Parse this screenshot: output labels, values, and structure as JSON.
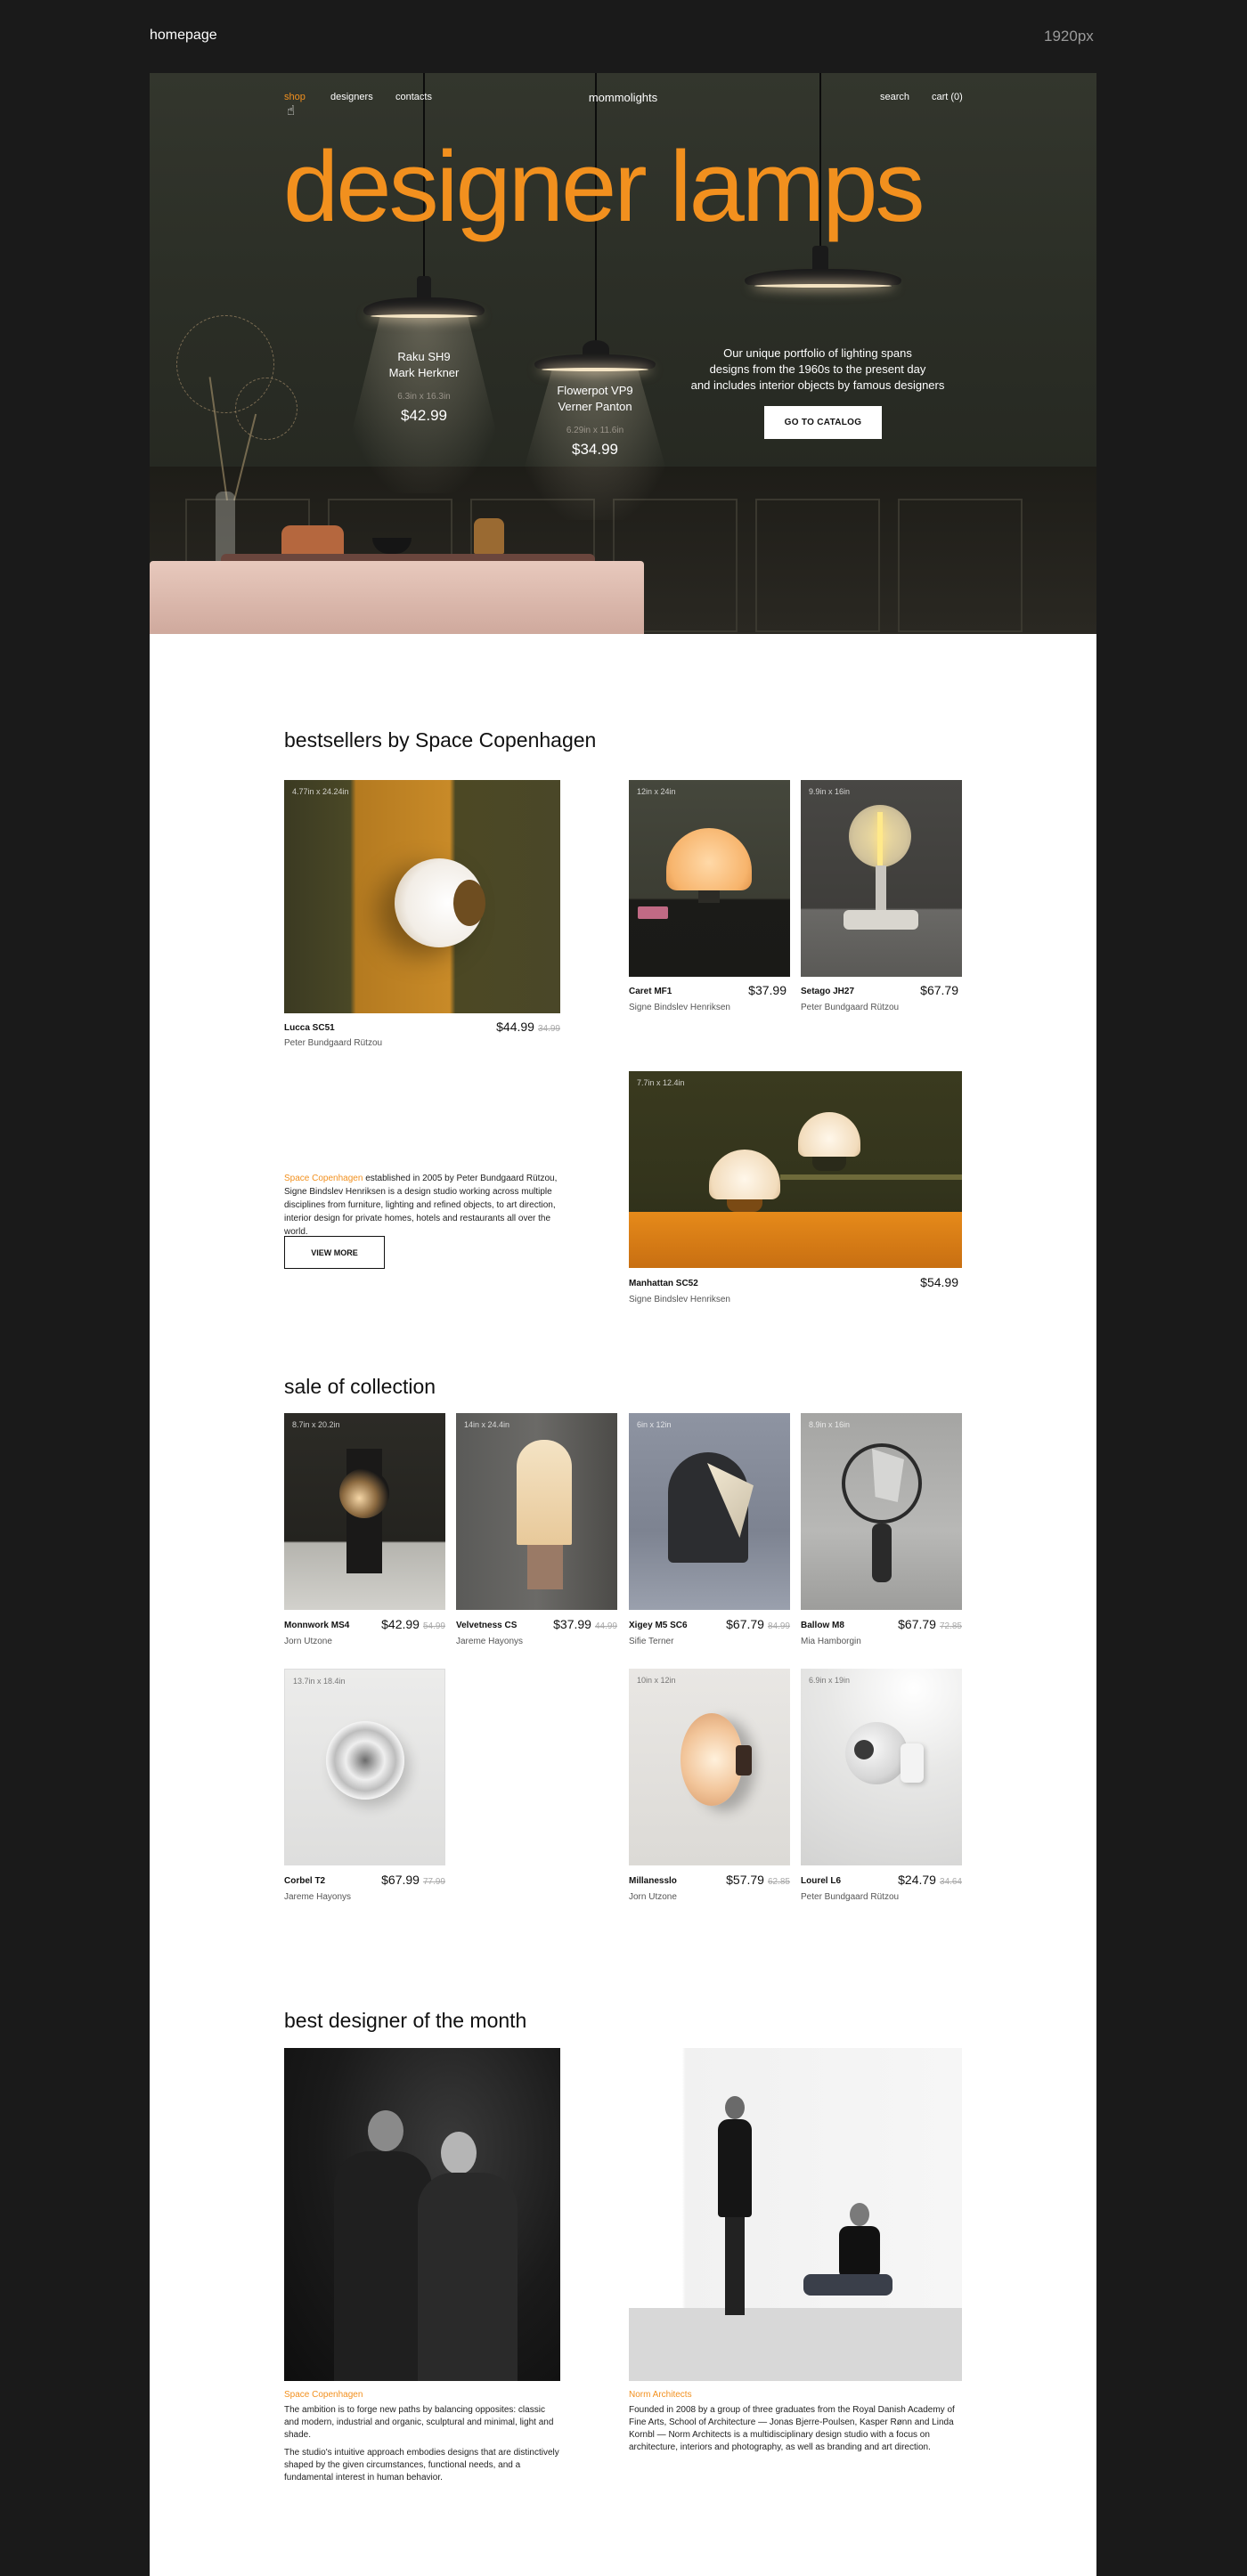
{
  "meta": {
    "page_label": "homepage",
    "width_label": "1920px"
  },
  "nav": {
    "shop": "shop",
    "designers": "designers",
    "contacts": "contacts",
    "brand": "mommolights",
    "search": "search",
    "cart": "cart (0)"
  },
  "hero": {
    "title": "designer lamps",
    "lamp1": {
      "name1": "Raku SH9",
      "name2": "Mark Herkner",
      "size": "6.3in x 16.3in",
      "price": "$42.99"
    },
    "lamp2": {
      "name1": "Flowerpot VP9",
      "name2": "Verner Panton",
      "size": "6.29in x 11.6in",
      "price": "$34.99"
    },
    "copy1": "Our unique portfolio of lighting spans",
    "copy2": "designs from the 1960s to the present day",
    "copy3": "and includes interior objects by famous designers",
    "cta": "GO TO CATALOG"
  },
  "bestsellers": {
    "title": "bestsellers by Space Copenhagen",
    "items": [
      {
        "dim": "4.77in x 24.24in",
        "name": "Lucca SC51",
        "designer": "Peter Bundgaard Rützou",
        "price": "$44.99",
        "old": "34.99"
      },
      {
        "dim": "12in x 24in",
        "name": "Caret MF1",
        "designer": "Signe Bindslev Henriksen",
        "price": "$37.99",
        "old": ""
      },
      {
        "dim": "9.9in x 16in",
        "name": "Setago JH27",
        "designer": "Peter Bundgaard Rützou",
        "price": "$67.79",
        "old": ""
      },
      {
        "dim": "7.7in x 12.4in",
        "name": "Manhattan SC52",
        "designer": "Signe Bindslev Henriksen",
        "price": "$54.99",
        "old": ""
      }
    ],
    "brand_name": "Space Copenhagen",
    "description": " established in 2005 by Peter Bundgaard Rützou, Signe Bindslev Henriksen is a design studio working across multiple disciplines from furniture, lighting and refined objects, to art direction, interior design for private homes, hotels and restaurants all over the world.",
    "view_more": "VIEW MORE"
  },
  "sale": {
    "title": "sale of collection",
    "items": [
      {
        "dim": "8.7in x 20.2in",
        "name": "Monnwork MS4",
        "designer": "Jorn Utzone",
        "price": "$42.99",
        "old": "54.99"
      },
      {
        "dim": "14in x 24.4in",
        "name": "Velvetness CS",
        "designer": "Jareme Hayonys",
        "price": "$37.99",
        "old": "44.99"
      },
      {
        "dim": "6in x 12in",
        "name": "Xigey M5 SC6",
        "designer": "Sifie Terner",
        "price": "$67.79",
        "old": "84.99"
      },
      {
        "dim": "8.9in x 16in",
        "name": "Ballow M8",
        "designer": "Mia Hamborgin",
        "price": "$67.79",
        "old": "72.85"
      },
      {
        "dim": "13.7in x 18.4in",
        "name": "Corbel T2",
        "designer": "Jareme Hayonys",
        "price": "$67.99",
        "old": "77.99"
      },
      {
        "dim": "10in x 12in",
        "name": "Millanesslo",
        "designer": "Jorn Utzone",
        "price": "$57.79",
        "old": "62.85"
      },
      {
        "dim": "6.9in x 19in",
        "name": "Lourel L6",
        "designer": "Peter Bundgaard Rützou",
        "price": "$24.79",
        "old": "34.64"
      }
    ]
  },
  "designers": {
    "title": "best designer of the month",
    "left": {
      "name": "Space Copenhagen",
      "p1": "The ambition is to forge new paths by balancing opposites: classic and modern, industrial and organic, sculptural and minimal, light and shade.",
      "p2": "The studio's intuitive approach embodies designs that are distinctively shaped by the given circumstances, functional needs, and a fundamental interest in human behavior."
    },
    "right": {
      "name": "Norm Architects",
      "p1": "Founded in 2008 by a group of three graduates from the Royal Danish Academy of Fine Arts, School of Architecture — Jonas Bjerre-Poulsen, Kasper Rønn and Linda Kornbl — Norm Architects is a multidisciplinary design studio with a focus on architecture, interiors and photography, as well as branding and art direction."
    }
  },
  "colors": {
    "accent": "#f2901e",
    "board": "#ffffff",
    "backdrop": "#1a1a1a"
  },
  "icons": {
    "cursor": "hand-pointer-icon"
  }
}
